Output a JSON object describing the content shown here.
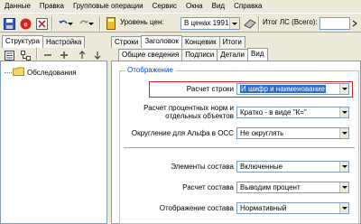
{
  "menu": [
    "Данные",
    "Правка",
    "Групповые операции",
    "Сервис",
    "Окна",
    "Вид",
    "Справка"
  ],
  "toolbar": {
    "price_level_label": "Уровень цен:",
    "price_level_value": "В ценах 1991 г.",
    "total_label": "Итог ЛС (Всего):",
    "total_value": ""
  },
  "left_tabs": [
    "Структура",
    "Настройка"
  ],
  "tree": {
    "items": [
      {
        "label": "Обследования"
      }
    ]
  },
  "top_tabs": [
    "Строки",
    "Заголовок",
    "Концевик",
    "Итоги"
  ],
  "sub_tabs": [
    "Общие сведения",
    "Подписи",
    "Детали",
    "Вид"
  ],
  "group": {
    "title": "Отображение",
    "rows": [
      {
        "label": "Расчет строки",
        "value": "И шифр и наименование"
      },
      {
        "label": "Расчет процентных норм и отдельных объектов",
        "value": "Кратко - в виде \"К=\""
      },
      {
        "label": "Округление для Альфа в ОСС",
        "value": "Не округлять"
      },
      {
        "label": "Элементы состава",
        "value": "Включенные"
      },
      {
        "label": "Расчет состава",
        "value": "Выводим процент"
      },
      {
        "label": "Отображение состава",
        "value": "Нормативный"
      }
    ]
  },
  "colors": {
    "selection": "#316ac5",
    "highlight": "#e02020",
    "group_title": "#0046d5"
  }
}
